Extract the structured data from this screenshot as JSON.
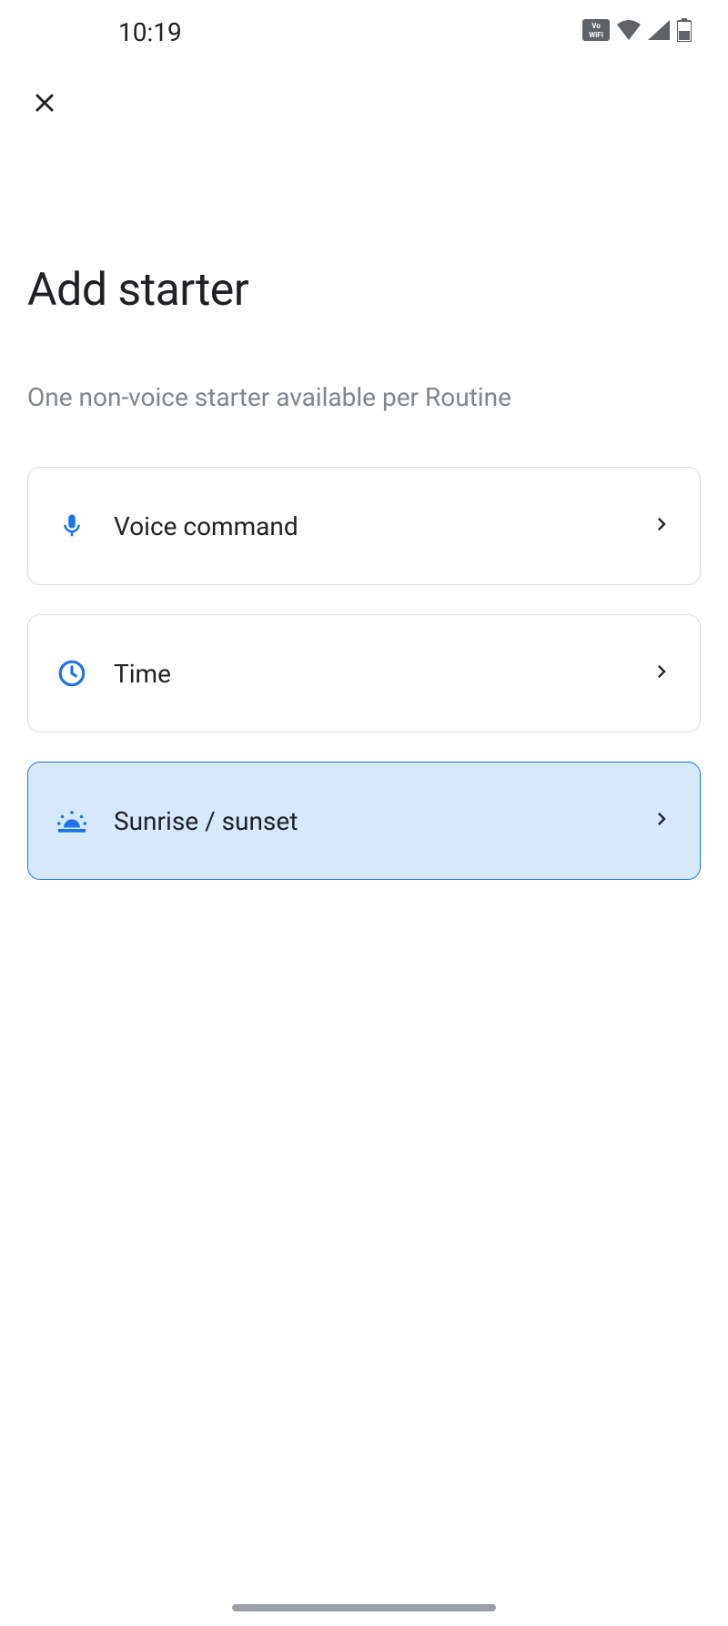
{
  "status": {
    "time": "10:19"
  },
  "page": {
    "title": "Add starter",
    "subtitle": "One non-voice starter available per Routine"
  },
  "options": [
    {
      "id": "voice-command",
      "label": "Voice command",
      "icon": "mic",
      "selected": false
    },
    {
      "id": "time",
      "label": "Time",
      "icon": "clock",
      "selected": false
    },
    {
      "id": "sunrise-sunset",
      "label": "Sunrise / sunset",
      "icon": "sunrise",
      "selected": true
    }
  ]
}
